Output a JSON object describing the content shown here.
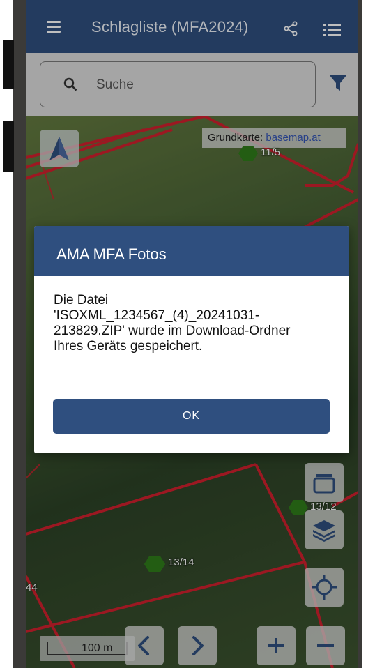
{
  "appbar": {
    "title": "Schlagliste (MFA2024)",
    "menu_icon": "hamburger-menu-icon",
    "share_icon": "share-icon",
    "list_icon": "list-icon"
  },
  "search": {
    "placeholder": "Suche",
    "filter_icon": "filter-icon"
  },
  "map": {
    "basemap_prefix": "Grundkarte: ",
    "basemap_link": "basemap.at",
    "field_labels": [
      "11/5",
      "13/12",
      "13/14",
      "44"
    ],
    "scale_label": "100 m",
    "buttons": [
      "layers-stack-icon",
      "layers-icon",
      "locate-icon",
      "prev-icon",
      "next-icon",
      "zoom-in-icon",
      "zoom-out-icon"
    ]
  },
  "dialog": {
    "title": "AMA MFA Fotos",
    "message": "Die Datei\n'ISOXML_1234567_(4)_20241031-\n213829.ZIP' wurde im Download-Ordner\nIhres Geräts gespeichert.",
    "ok_label": "OK"
  },
  "colors": {
    "primary": "#2f4f7f",
    "field_border": "#d0202e",
    "marker": "#2f7d1a"
  }
}
